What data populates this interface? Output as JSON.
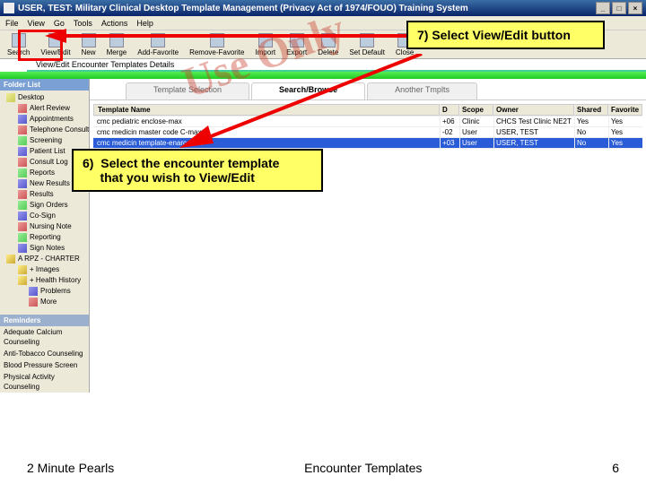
{
  "window": {
    "title": "USER, TEST: Military Clinical Desktop   Template Management (Privacy Act of 1974/FOUO)   Training System"
  },
  "menu": [
    "File",
    "View",
    "Go",
    "Tools",
    "Actions",
    "Help"
  ],
  "toolbar": [
    {
      "label": "Search"
    },
    {
      "label": "View/Edit"
    },
    {
      "label": "New"
    },
    {
      "label": "Merge"
    },
    {
      "label": "Add-Favorite"
    },
    {
      "label": "Remove-Favorite"
    },
    {
      "label": "Import"
    },
    {
      "label": "Export"
    },
    {
      "label": "Delete"
    },
    {
      "label": "Set Default"
    },
    {
      "label": "Close"
    }
  ],
  "subtitle": "View/Edit Encounter Templates Details",
  "sidebar": {
    "header": "Folder List",
    "items": [
      "Desktop",
      "Alert Review",
      "Appointments",
      "Telephone Consult",
      "Screening",
      "Patient List",
      "Consult Log",
      "Reports",
      "New Results",
      "Results",
      "Sign Orders",
      "Co-Sign",
      "Nursing Note",
      "Reporting",
      "Sign Notes",
      "A RPZ - CHARTER",
      "+ Images",
      "+ Health History",
      "Problems",
      "More"
    ]
  },
  "reminders": {
    "header": "Reminders",
    "items": [
      "Adequate Calcium Counseling",
      "Anti-Tobacco Counseling",
      "Blood Pressure Screen",
      "Physical Activity Counseling"
    ]
  },
  "tabs": [
    {
      "label": "Template Selection",
      "active": false
    },
    {
      "label": "Search/Browse",
      "active": true
    },
    {
      "label": "Another Tmplts",
      "active": false
    }
  ],
  "table": {
    "nameHeader": "Template Name",
    "cols": [
      "D",
      "Scope",
      "Owner",
      "Shared",
      "Favorite"
    ],
    "rows": [
      {
        "name": "cmc pediatric enclose-max",
        "d": "+06",
        "scope": "Clinic",
        "owner": "CHCS Test Clinic NE2T",
        "shared": "Yes",
        "fav": "Yes",
        "selected": false
      },
      {
        "name": "cmc medicin master code C-max",
        "d": "-02",
        "scope": "User",
        "owner": "USER, TEST",
        "shared": "No",
        "fav": "Yes",
        "selected": false
      },
      {
        "name": "cmc medicin template-enarc-max",
        "d": "+03",
        "scope": "User",
        "owner": "USER, TEST",
        "shared": "No",
        "fav": "Yes",
        "selected": true
      }
    ]
  },
  "callouts": {
    "c7": "7) Select View/Edit button",
    "c6": "6)  Select the encounter template\n     that you wish to View/Edit"
  },
  "watermark": "Use Only",
  "footer": {
    "left": "2 Minute Pearls",
    "center": "Encounter Templates",
    "right": "6"
  }
}
